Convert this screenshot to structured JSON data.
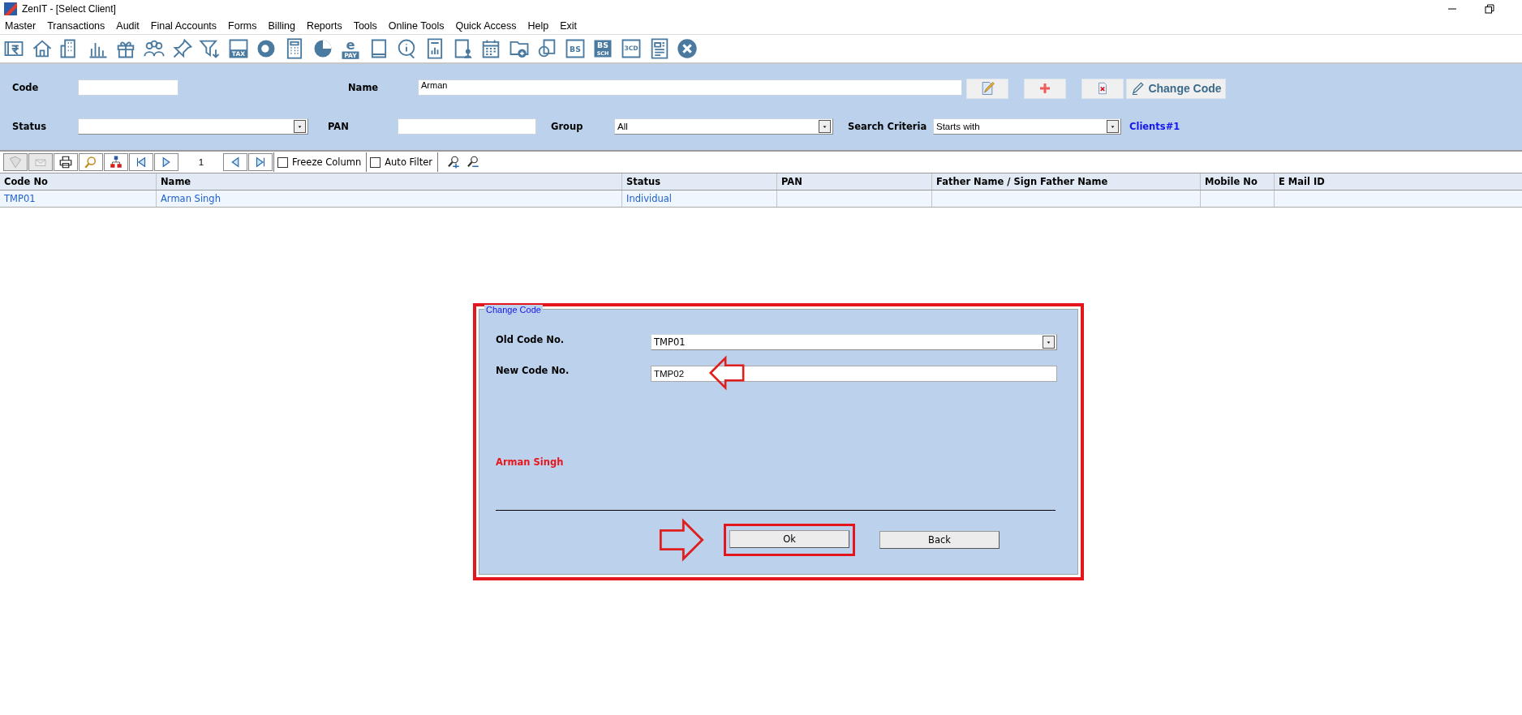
{
  "window": {
    "title": "ZenIT - [Select Client]"
  },
  "menu": [
    "Master",
    "Transactions",
    "Audit",
    "Final Accounts",
    "Forms",
    "Billing",
    "Reports",
    "Tools",
    "Online Tools",
    "Quick Access",
    "Help",
    "Exit"
  ],
  "toolbar": [
    {
      "kind": "rupee"
    },
    {
      "kind": "home"
    },
    {
      "kind": "building"
    },
    {
      "kind": "bars"
    },
    {
      "kind": "gift"
    },
    {
      "kind": "people"
    },
    {
      "kind": "pin"
    },
    {
      "kind": "filter"
    },
    {
      "kind": "tax",
      "texts": [
        "TAX"
      ]
    },
    {
      "kind": "disc"
    },
    {
      "kind": "calculator"
    },
    {
      "kind": "pie"
    },
    {
      "kind": "epay",
      "texts": [
        "e",
        "PAY"
      ]
    },
    {
      "kind": "book"
    },
    {
      "kind": "info"
    },
    {
      "kind": "report"
    },
    {
      "kind": "userdoc"
    },
    {
      "kind": "calendar"
    },
    {
      "kind": "folderadd"
    },
    {
      "kind": "copy"
    },
    {
      "kind": "bs",
      "texts": [
        "BS"
      ]
    },
    {
      "kind": "bssch",
      "texts": [
        "BS",
        "SCH"
      ]
    },
    {
      "kind": "cd",
      "texts": [
        "3CD"
      ]
    },
    {
      "kind": "sheet"
    },
    {
      "kind": "close"
    }
  ],
  "search": {
    "code": {
      "label": "Code"
    },
    "name": {
      "label": "Name",
      "value": "Arman"
    },
    "actions": [
      {
        "kind": "edit"
      },
      {
        "kind": "add"
      },
      {
        "kind": "delete"
      },
      {
        "kind": "change",
        "label": "Change Code"
      }
    ],
    "status": {
      "label": "Status"
    },
    "pan": {
      "label": "PAN"
    },
    "group": {
      "label": "Group",
      "value": "All"
    },
    "search_criteria": {
      "label": "Search Criteria",
      "value": "Starts with"
    },
    "count": "Clients#1"
  },
  "grid_toolbar": {
    "page": "1",
    "options": [
      {
        "label": "Freeze Column",
        "checked": false
      },
      {
        "label": "Auto Filter",
        "checked": false
      }
    ]
  },
  "table": {
    "columns": [
      "Code No",
      "Name",
      "Status",
      "PAN",
      "Father Name / Sign Father Name",
      "Mobile No",
      "E Mail ID"
    ],
    "rows": [
      {
        "cells": [
          "TMP01",
          "Arman Singh",
          "Individual"
        ]
      }
    ]
  },
  "dialog": {
    "title": "Change Code",
    "highlighted": true,
    "fields": [
      {
        "kind": "select",
        "label": "Old Code No.",
        "value": "TMP01",
        "pointed": false
      },
      {
        "kind": "input",
        "label": "New Code No.",
        "value": "TMP02",
        "pointed": true
      }
    ],
    "client_name": "Arman Singh",
    "buttons": [
      {
        "label": "Ok",
        "highlighted": true
      },
      {
        "label": "Back",
        "highlighted": false
      }
    ]
  }
}
